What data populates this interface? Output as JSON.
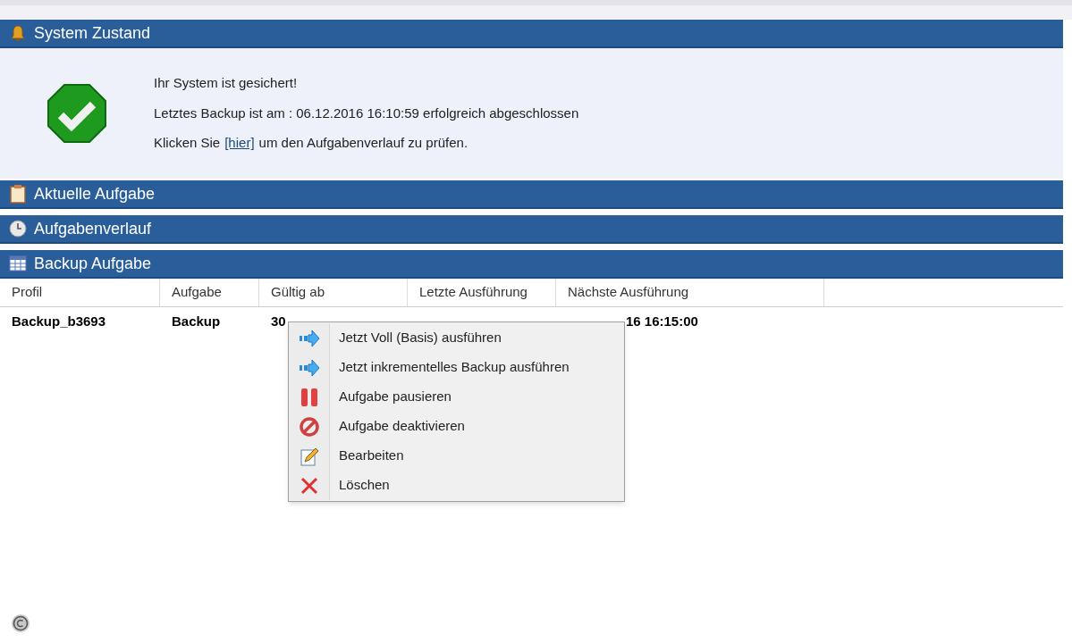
{
  "sections": [
    {
      "title": "System Zustand",
      "kind": "bell",
      "expanded": true,
      "lines": [
        {
          "text": "Ihr System ist gesichert!"
        },
        {
          "text": "Letztes Backup ist am : 06.12.2016 16:10:59 erfolgreich abgeschlossen"
        },
        {
          "text": "Klicken Sie",
          "link": "[hier]",
          "after": "um den Aufgabenverlauf zu prüfen."
        }
      ]
    },
    {
      "title": "Aktuelle Aufgabe",
      "kind": "clipboard",
      "expanded": false
    },
    {
      "title": "Aufgabenverlauf",
      "kind": "clock",
      "expanded": false
    },
    {
      "title": "Backup Aufgabe",
      "kind": "table",
      "expanded": true
    }
  ],
  "table": {
    "columns": [
      "Profil",
      "Aufgabe",
      "Gültig ab",
      "Letzte Ausführung",
      "Nächste Ausführung"
    ],
    "rows": [
      {
        "cells": [
          "Backup_b3693",
          "Backup",
          "30",
          null,
          "16 16:15:00"
        ]
      }
    ]
  },
  "context_menu": {
    "items": [
      {
        "label": "Jetzt Voll (Basis) ausführen",
        "kind": "run"
      },
      {
        "label": "Jetzt inkrementelles Backup ausführen",
        "kind": "run"
      },
      {
        "label": "Aufgabe pausieren",
        "kind": "pause"
      },
      {
        "label": "Aufgabe deaktivieren",
        "kind": "disable"
      },
      {
        "label": "Bearbeiten",
        "kind": "edit"
      },
      {
        "label": "Löschen",
        "kind": "delete"
      }
    ]
  }
}
